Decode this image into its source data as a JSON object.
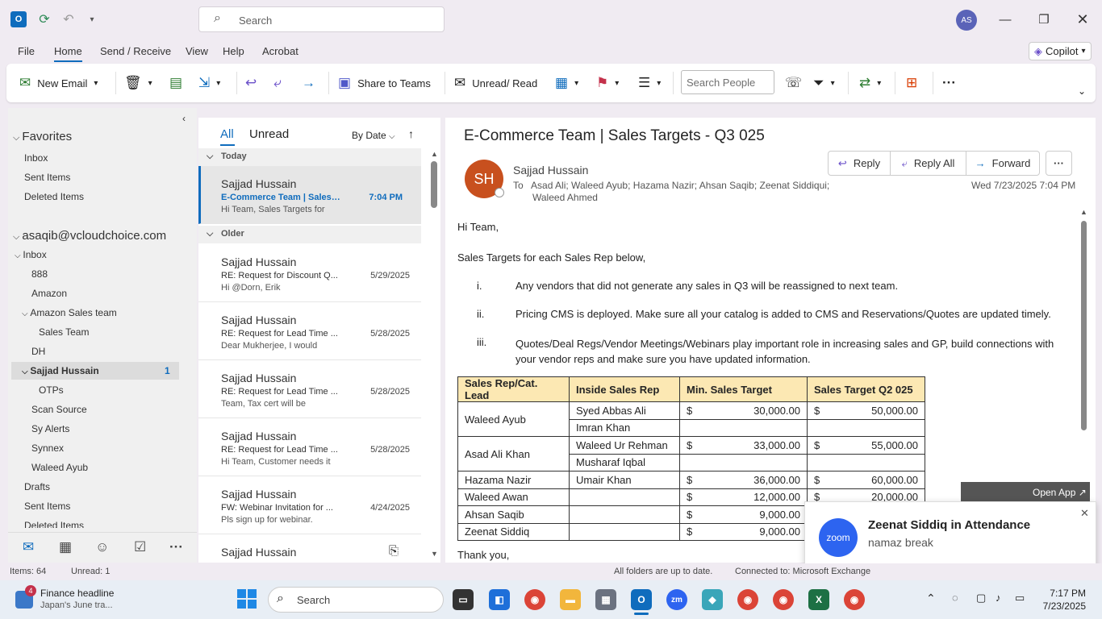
{
  "titlebar": {
    "search_placeholder": "Search",
    "avatar_initials": "AS"
  },
  "menu": {
    "file": "File",
    "home": "Home",
    "send_receive": "Send / Receive",
    "view": "View",
    "help": "Help",
    "acrobat": "Acrobat",
    "copilot": "Copilot"
  },
  "ribbon": {
    "new_email": "New Email",
    "share_to_teams": "Share to Teams",
    "unread_read": "Unread/ Read",
    "search_people_placeholder": "Search People"
  },
  "nav": {
    "favorites": "Favorites",
    "fav_items": [
      "Inbox",
      "Sent Items",
      "Deleted Items"
    ],
    "account": "asaqib@vcloudchoice.com",
    "inbox": "Inbox",
    "folders": [
      "888",
      "Amazon",
      "Amazon Sales team",
      "Sales Team",
      "DH",
      "Sajjad Hussain",
      "OTPs",
      "Scan Source",
      "Sy Alerts",
      "Synnex",
      "Waleed Ayub",
      "Drafts",
      "Sent Items",
      "Deleted Items"
    ],
    "sajjad_count": "1"
  },
  "list": {
    "tab_all": "All",
    "tab_unread": "Unread",
    "sort": "By Date",
    "group_today": "Today",
    "group_older": "Older",
    "messages": [
      {
        "from": "Sajjad Hussain",
        "subject": "E-Commerce Team | Sales ...",
        "date": "7:04 PM",
        "preview": "Hi Team,  Sales Targets for"
      },
      {
        "from": "Sajjad Hussain",
        "subject": "RE: Request for Discount Q...",
        "date": "5/29/2025",
        "preview": "Hi @Dorn, Erik"
      },
      {
        "from": "Sajjad Hussain",
        "subject": "RE: Request for Lead Time ...",
        "date": "5/28/2025",
        "preview": "Dear Mukherjee,    I would"
      },
      {
        "from": "Sajjad Hussain",
        "subject": "RE: Request for Lead Time ...",
        "date": "5/28/2025",
        "preview": "Team, Tax cert will be"
      },
      {
        "from": "Sajjad Hussain",
        "subject": "RE: Request for Lead Time ...",
        "date": "5/28/2025",
        "preview": "Hi Team,  Customer needs it"
      },
      {
        "from": "Sajjad Hussain",
        "subject": "FW: Webinar Invitation for ...",
        "date": "4/24/2025",
        "preview": "Pls sign up for webinar."
      },
      {
        "from": "Sajjad Hussain",
        "subject": "",
        "date": "",
        "preview": ""
      }
    ]
  },
  "email": {
    "subject": "E-Commerce Team | Sales Targets - Q3 025",
    "sender_initials": "SH",
    "sender": "Sajjad Hussain",
    "to_label": "To",
    "recipients": "Asad Ali;  Waleed Ayub;  Hazama Nazir;  Ahsan Saqib;  Zeenat Siddiqui;",
    "recipients2": "Waleed Ahmed",
    "date": "Wed 7/23/2025 7:04 PM",
    "reply": "Reply",
    "reply_all": "Reply All",
    "forward": "Forward",
    "greeting": "Hi Team,",
    "intro": "Sales Targets for each Sales Rep below,",
    "points": [
      {
        "num": "i.",
        "text": "Any vendors that did not generate any sales in Q3 will be reassigned to next team."
      },
      {
        "num": "ii.",
        "text": "Pricing CMS is deployed. Make sure all your catalog is added to CMS and Reservations/Quotes are updated timely."
      },
      {
        "num": "iii.",
        "text": "Quotes/Deal Regs/Vendor Meetings/Webinars play important role in increasing sales and GP, build connections with your vendor reps and make sure you have updated information."
      }
    ],
    "table_headers": [
      "Sales Rep/Cat. Lead",
      "Inside Sales Rep",
      "Min. Sales Target",
      "Sales Target Q2 025"
    ],
    "table_rows": [
      [
        "Waleed Ayub",
        "Syed Abbas Ali",
        "30,000.00",
        "50,000.00"
      ],
      [
        "",
        "Imran Khan",
        "",
        ""
      ],
      [
        "Asad Ali Khan",
        "Waleed Ur Rehman",
        "33,000.00",
        "55,000.00"
      ],
      [
        "",
        "Musharaf Iqbal",
        "",
        ""
      ],
      [
        "Hazama Nazir",
        "Umair Khan",
        "36,000.00",
        "60,000.00"
      ],
      [
        "Waleed Awan",
        "",
        "12,000.00",
        "20,000.00"
      ],
      [
        "Ahsan Saqib",
        "",
        "9,000.00",
        ""
      ],
      [
        "Zeenat Siddiq",
        "",
        "9,000.00",
        ""
      ]
    ],
    "currency": "$",
    "closing": "Thank you,"
  },
  "toast": {
    "open_app": "Open App",
    "title": "Zeenat Siddiq in Attendance",
    "body": "namaz break",
    "icon_text": "zoom"
  },
  "status": {
    "items": "Items: 64",
    "unread": "Unread: 1",
    "sync": "All folders are up to date.",
    "connected": "Connected to: Microsoft Exchange"
  },
  "taskbar": {
    "news_title": "Finance headline",
    "news_sub": "Japan's June tra...",
    "news_badge": "4",
    "search": "Search",
    "time": "7:17 PM",
    "date": "7/23/2025"
  }
}
